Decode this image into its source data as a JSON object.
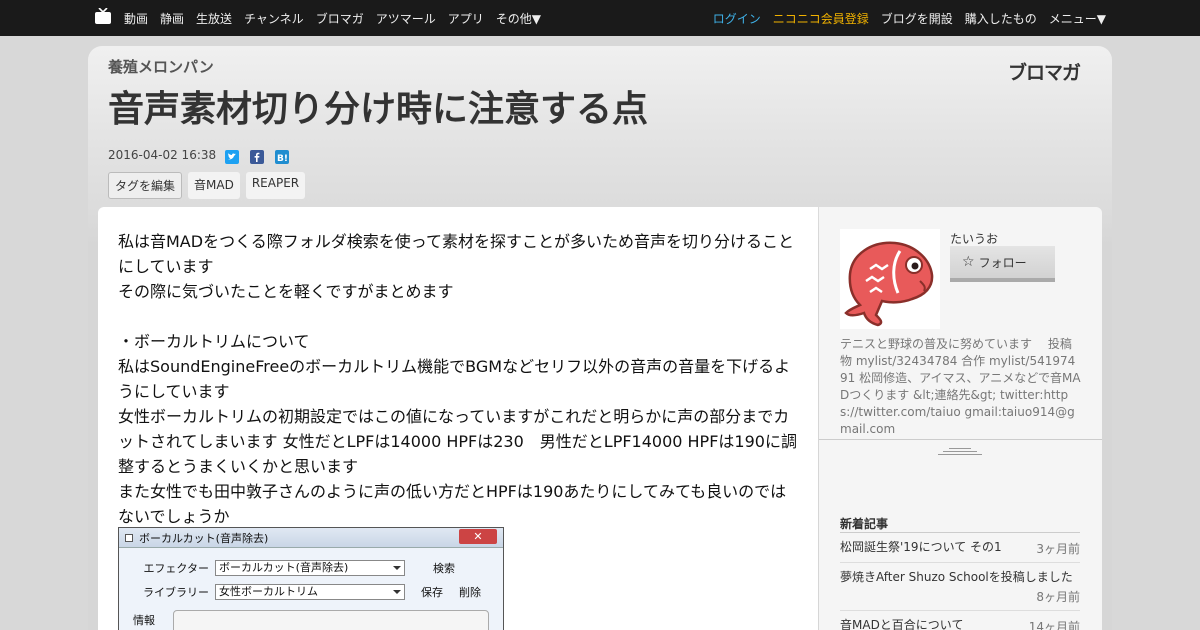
{
  "nav": {
    "left": [
      "動画",
      "静画",
      "生放送",
      "チャンネル",
      "ブロマガ",
      "アツマール",
      "アプリ",
      "その他▼"
    ],
    "login": "ログイン",
    "premium": "ニコニコ会員登録",
    "right": [
      "ブログを開設",
      "購入したもの",
      "メニュー▼"
    ]
  },
  "header": {
    "blog_name": "養殖メロンパン",
    "logo": "ブロマガ",
    "title": "音声素材切り分け時に注意する点",
    "date": "2016-04-02 16:38",
    "tag_edit": "タグを編集",
    "tags": [
      "音MAD",
      "REAPER"
    ]
  },
  "article": {
    "lines": [
      "私は音MADをつくる際フォルダ検索を使って素材を探すことが多いため音声を切り分けることにしています",
      "その際に気づいたことを軽くですがまとめます",
      "",
      "・ボーカルトリムについて",
      "私はSoundEngineFreeのボーカルトリム機能でBGMなどセリフ以外の音声の音量を下げるようにしています",
      "女性ボーカルトリムの初期設定ではこの値になっていますがこれだと明らかに声の部分までカットされてしまいます 女性だとLPFは14000 HPFは230　男性だとLPF14000 HPFは190に調整するとうまくいくかと思います",
      "また女性でも田中敦子さんのように声の低い方だとHPFは190あたりにしてみても良いのではないでしょうか"
    ]
  },
  "figure": {
    "title": "ボーカルカット(音声除去)",
    "close": "✕",
    "effector_label": "エフェクター",
    "effector_value": "ボーカルカット(音声除去)",
    "search": "検索",
    "library_label": "ライブラリー",
    "library_value": "女性ボーカルトリム",
    "save": "保存",
    "delete": "削除",
    "info_label": "情報"
  },
  "sidebar": {
    "username": "たいうお",
    "follow": "フォロー",
    "profile": "テニスと野球の普及に努めています　 投稿物 mylist/32434784 合作 mylist/54197491 松岡修造、アイマス、アニメなどで音MADつくります &lt;連絡先&gt; twitter:https://twitter.com/taiuo gmail:taiuo914@gmail.com",
    "recent_heading": "新着記事",
    "recent": [
      {
        "title": "松岡誕生祭'19について その1",
        "ago": "3ヶ月前"
      },
      {
        "title": "夢焼きAfter Shuzo Schoolを投稿しました",
        "ago": "8ヶ月前"
      },
      {
        "title": "音MADと百合について",
        "ago": "14ヶ月前"
      }
    ]
  },
  "colors": {
    "topbar": "#1a1a1a",
    "login": "#3fb1e8",
    "premium": "#f0b100",
    "avatar_fish": "#e85a5a"
  }
}
